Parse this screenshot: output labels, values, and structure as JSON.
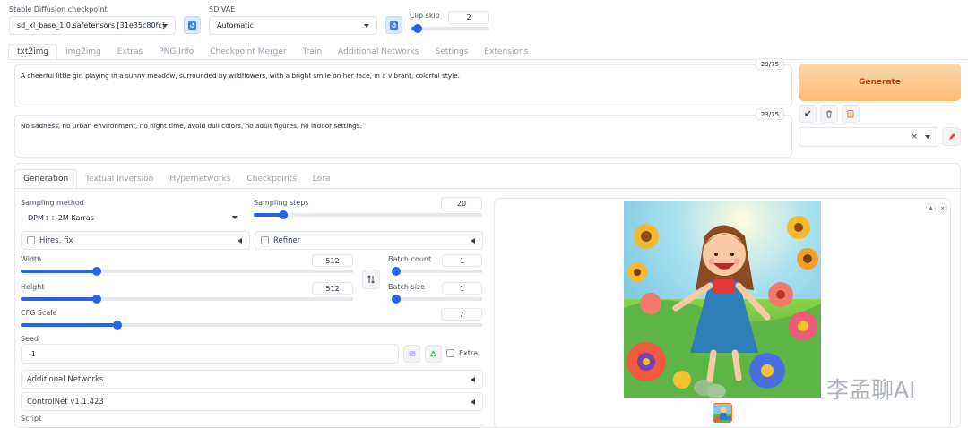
{
  "top": {
    "checkpoint_label": "Stable Diffusion checkpoint",
    "checkpoint_value": "sd_xl_base_1.0.safetensors [31e35c80fc]",
    "vae_label": "SD VAE",
    "vae_value": "Automatic",
    "clip_skip_label": "Clip skip",
    "clip_skip_value": "2",
    "clip_skip_fraction": 0.08
  },
  "main_tabs": [
    "txt2img",
    "img2img",
    "Extras",
    "PNG Info",
    "Checkpoint Merger",
    "Train",
    "Additional Networks",
    "Settings",
    "Extensions"
  ],
  "prompt": {
    "text": "A cheerful little girl playing in a sunny meadow, surrounded by wildflowers, with a bright smile on her face, in a vibrant, colorful style.",
    "token_count": "29/75"
  },
  "negative_prompt": {
    "text": "No sadness, no urban environment, no night time, avoid dull colors, no adult figures, no indoor settings.",
    "token_count": "23/75"
  },
  "generate_label": "Generate",
  "styles_clear": "×",
  "sub_tabs": [
    "Generation",
    "Textual Inversion",
    "Hypernetworks",
    "Checkpoints",
    "Lora"
  ],
  "params": {
    "sampling_method_label": "Sampling method",
    "sampling_method_value": "DPM++ 2M Karras",
    "sampling_steps_label": "Sampling steps",
    "sampling_steps_value": "20",
    "sampling_steps_fraction": 0.13,
    "hires_label": "Hires. fix",
    "refiner_label": "Refiner",
    "width_label": "Width",
    "width_value": "512",
    "width_fraction": 0.23,
    "height_label": "Height",
    "height_value": "512",
    "height_fraction": 0.23,
    "batch_count_label": "Batch count",
    "batch_count_value": "1",
    "batch_count_fraction": 0.0,
    "batch_size_label": "Batch size",
    "batch_size_value": "1",
    "batch_size_fraction": 0.0,
    "cfg_label": "CFG Scale",
    "cfg_value": "7",
    "cfg_fraction": 0.21,
    "seed_label": "Seed",
    "seed_value": "-1",
    "extra_label": "Extra",
    "additional_networks_label": "Additional Networks",
    "controlnet_label": "ControlNet v1.1.423",
    "script_label": "Script"
  },
  "watermark": "李孟聊AI",
  "colors": {
    "accent": "#2563eb",
    "generate_start": "#fed7aa",
    "generate_end": "#fdba74",
    "generate_text": "#c2410c",
    "blue_icon_bg": "#dbeafe"
  }
}
